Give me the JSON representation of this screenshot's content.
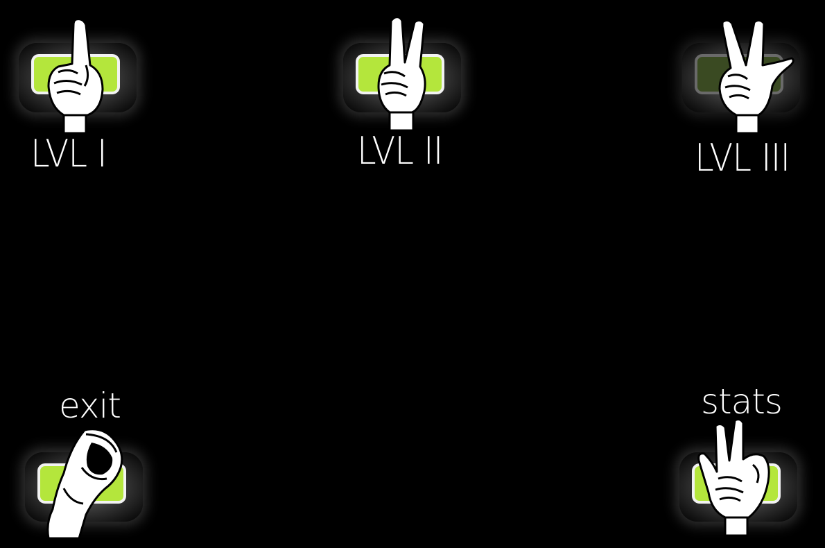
{
  "levels": [
    {
      "label": "LVL I",
      "enabled": true,
      "icon": "hand-sign-one-icon"
    },
    {
      "label": "LVL II",
      "enabled": true,
      "icon": "hand-sign-two-icon"
    },
    {
      "label": "LVL III",
      "enabled": false,
      "icon": "hand-sign-three-icon"
    }
  ],
  "exit": {
    "label": "exit",
    "icon": "hand-sign-o-icon"
  },
  "stats": {
    "label": "stats",
    "icon": "hand-sign-w-icon"
  },
  "colors": {
    "background": "#000000",
    "button_active": "#b4e63c",
    "button_inactive": "#3a4a22",
    "button_border": "#f2f2f2",
    "text": "#ffffff"
  }
}
